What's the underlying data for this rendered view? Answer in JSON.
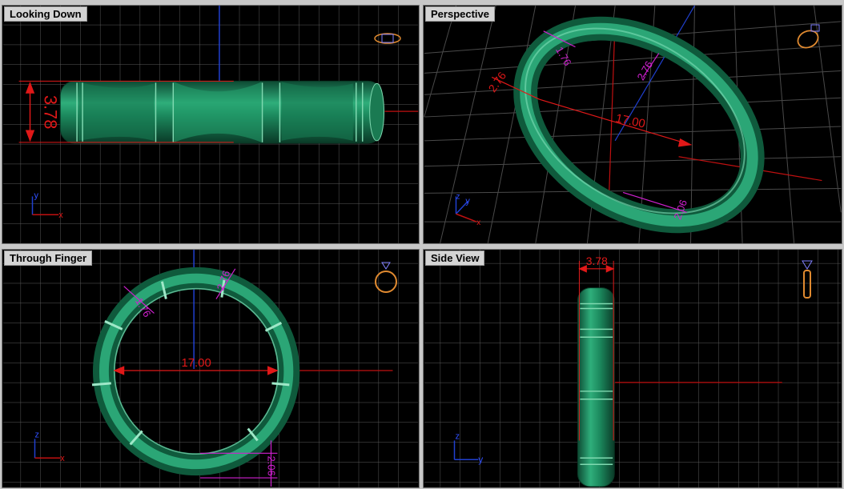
{
  "viewports": [
    {
      "title": "Looking Down",
      "dims": [
        "3.78"
      ],
      "axes": {
        "a": "y",
        "b": "x"
      }
    },
    {
      "title": "Perspective",
      "dims": [
        "17.00",
        "2.76",
        "1.76",
        "2.76",
        "2.06"
      ],
      "axes": {
        "a": "z",
        "b": "y",
        "c": "x"
      }
    },
    {
      "title": "Through Finger",
      "dims": [
        "17.00",
        "1.76",
        "2.76",
        "2.06"
      ],
      "axes": {
        "a": "z",
        "b": "x"
      }
    },
    {
      "title": "Side View",
      "dims": [
        "3.78"
      ],
      "axes": {
        "a": "z",
        "b": "y"
      }
    }
  ],
  "colors": {
    "background": "#000000",
    "grid": "#5a5a5a",
    "ring": "#1f8a5f",
    "dimension_red": "#e01818",
    "dimension_magenta": "#d020d0",
    "axis_blue": "#2040d0",
    "icon_orange": "#e08a30"
  },
  "icons": [
    "ring-top-icon",
    "ring-perspective-icon",
    "ring-front-icon",
    "ring-side-icon"
  ]
}
